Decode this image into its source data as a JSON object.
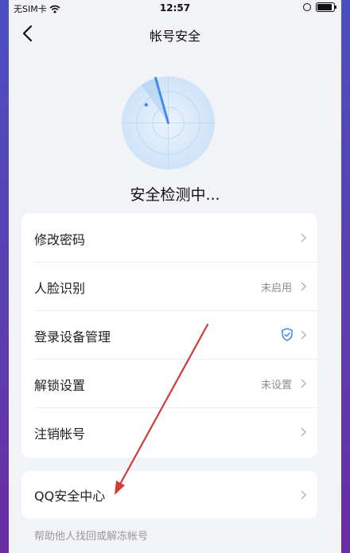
{
  "status_bar": {
    "carrier": "无SIM卡",
    "time": "12:57"
  },
  "nav": {
    "title": "帐号安全"
  },
  "scan": {
    "text": "安全检测中..."
  },
  "settings": [
    {
      "label": "修改密码",
      "status": ""
    },
    {
      "label": "人脸识别",
      "status": "未启用"
    },
    {
      "label": "登录设备管理",
      "status": ""
    },
    {
      "label": "解锁设置",
      "status": "未设置"
    },
    {
      "label": "注销帐号",
      "status": ""
    }
  ],
  "qq_center": {
    "label": "QQ安全中心"
  },
  "help_link": "帮助他人找回或解冻帐号",
  "colors": {
    "accent_blue": "#3f8cf0",
    "annotation_red": "#d33a3a"
  }
}
